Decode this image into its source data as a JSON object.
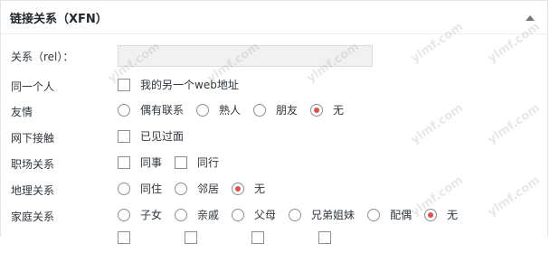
{
  "panel": {
    "title": "链接关系（XFN）"
  },
  "rows": {
    "rel": {
      "label": "关系（rel）：",
      "value": ""
    },
    "identity": {
      "label": "同一个人",
      "options": [
        "我的另一个web地址"
      ]
    },
    "friendship": {
      "label": "友情",
      "options": [
        "偶有联系",
        "熟人",
        "朋友",
        "无"
      ],
      "selected": "无"
    },
    "physical": {
      "label": "网下接触",
      "options": [
        "已见过面"
      ]
    },
    "professional": {
      "label": "职场关系",
      "options": [
        "同事",
        "同行"
      ]
    },
    "geographical": {
      "label": "地理关系",
      "options": [
        "同住",
        "邻居",
        "无"
      ],
      "selected": "无"
    },
    "family": {
      "label": "家庭关系",
      "options": [
        "子女",
        "亲戚",
        "父母",
        "兄弟姐妹",
        "配偶",
        "无"
      ],
      "selected": "无"
    }
  },
  "watermark": "ylmf.com",
  "colors": {
    "radio_selected": "#d9534f",
    "field_bg": "#f1f1f1"
  }
}
